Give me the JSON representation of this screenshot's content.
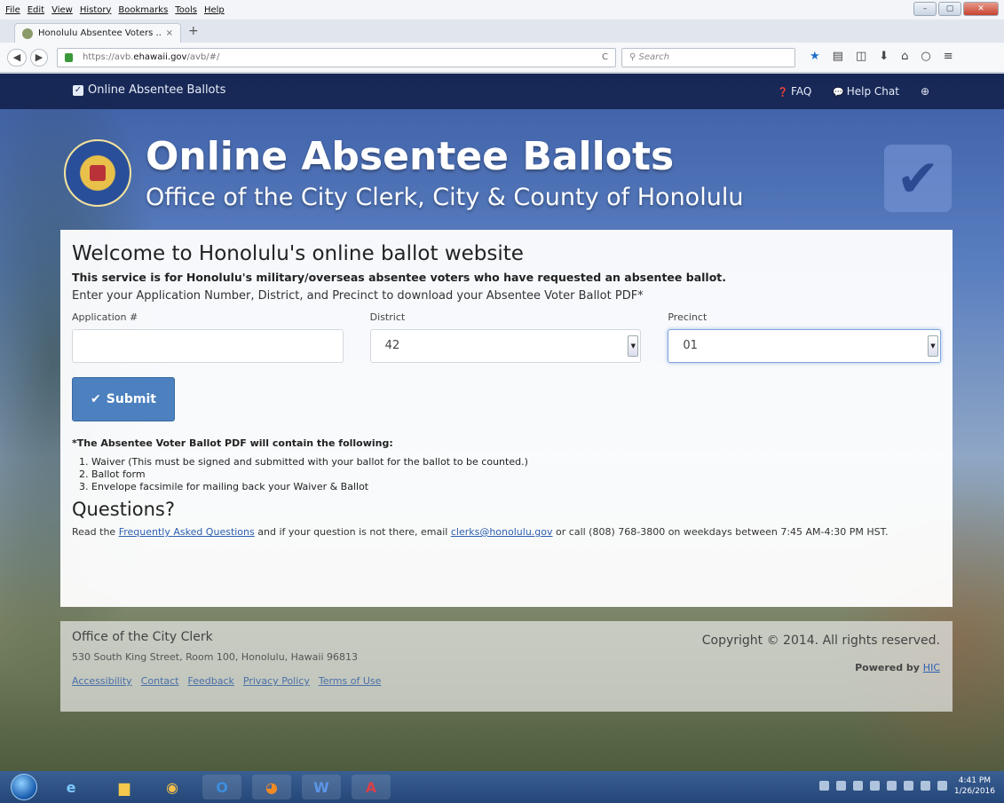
{
  "browser": {
    "menu": [
      "File",
      "Edit",
      "View",
      "History",
      "Bookmarks",
      "Tools",
      "Help"
    ],
    "tab_title": "Honolulu Absentee Voters ...",
    "tab_close": "×",
    "new_tab": "+",
    "url_prefix": "https://avb.",
    "url_domain": "ehawaii.gov",
    "url_path": "/avb/#/",
    "reload": "C",
    "search_placeholder": "Search"
  },
  "topnav": {
    "brand": "Online Absentee Ballots",
    "faq": "FAQ",
    "help_chat": "Help Chat"
  },
  "hero": {
    "title": "Online Absentee Ballots",
    "subtitle": "Office of the City Clerk, City & County of Honolulu"
  },
  "main": {
    "heading": "Welcome to Honolulu's online ballot website",
    "lead": "This service is for Honolulu's military/overseas absentee voters who have requested an absentee ballot.",
    "instructions": "Enter your Application Number, District, and Precinct to download your Absentee Voter Ballot PDF*",
    "fields": {
      "application_label": "Application #",
      "application_value": "",
      "district_label": "District",
      "district_value": "42",
      "precinct_label": "Precinct",
      "precinct_value": "01"
    },
    "submit_label": "Submit",
    "note": "*The Absentee Voter Ballot PDF will contain the following:",
    "contents": [
      "Waiver (This must be signed and submitted with your ballot for the ballot to be counted.)",
      "Ballot form",
      "Envelope facsimile for mailing back your Waiver & Ballot"
    ],
    "questions_heading": "Questions?",
    "questions": {
      "prefix": "Read the ",
      "faq_link": "Frequently Asked Questions",
      "middle": " and if your question is not there, email ",
      "email_link": "clerks@honolulu.gov",
      "suffix": " or call (808) 768-3800 on weekdays between 7:45 AM-4:30 PM HST."
    }
  },
  "footer": {
    "org": "Office of the City Clerk",
    "address": "530 South King Street, Room 100, Honolulu, Hawaii 96813",
    "links": [
      "Accessibility",
      "Contact",
      "Feedback",
      "Privacy Policy",
      "Terms of Use"
    ],
    "copyright": "Copyright © 2014. All rights reserved.",
    "powered_prefix": "Powered by ",
    "powered_link": "HIC"
  },
  "taskbar": {
    "time": "4:41 PM",
    "date": "1/26/2016"
  },
  "colors": {
    "navbar": "#1e2d5c",
    "submit": "#4c80be",
    "link": "#2c5fb0"
  }
}
